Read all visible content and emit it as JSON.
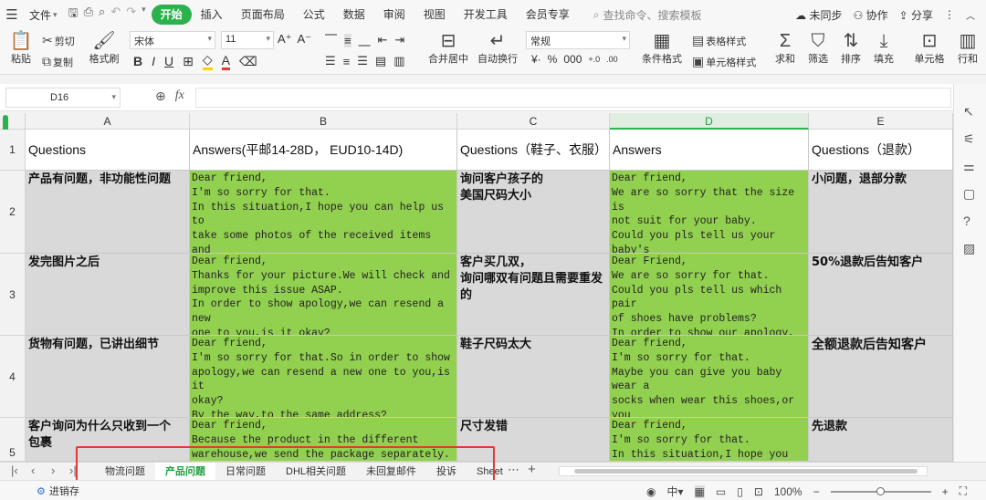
{
  "menubar": {
    "file": "文件",
    "tabs": [
      "开始",
      "插入",
      "页面布局",
      "公式",
      "数据",
      "审阅",
      "视图",
      "开发工具",
      "会员专享"
    ],
    "active_tab": "开始",
    "search_placeholder": "查找命令、搜索模板",
    "sync": "未同步",
    "collab": "协作",
    "share": "分享"
  },
  "ribbon": {
    "paste": "粘贴",
    "cut": "剪切",
    "copy": "复制",
    "format_painter": "格式刷",
    "font_name": "宋体",
    "font_size": "11",
    "merge": "合并居中",
    "wrap": "自动换行",
    "number_format": "常规",
    "table_style": "表格样式",
    "cond_format": "条件格式",
    "cell_style": "单元格样式",
    "sum": "求和",
    "filter": "筛选",
    "sort": "排序",
    "fill": "填充",
    "cell": "单元格",
    "rowcol": "行和"
  },
  "formula": {
    "name_box": "D16",
    "fx": "fx"
  },
  "columns": [
    "A",
    "B",
    "C",
    "D",
    "E"
  ],
  "active_column": "D",
  "rows": [
    "1",
    "2",
    "3",
    "4",
    "5"
  ],
  "cells": {
    "A1": "Questions",
    "B1": "Answers(平邮14-28D， EUD10-14D)",
    "C1": "Questions（鞋子、衣服）",
    "D1": "Answers",
    "E1": "Questions（退款）",
    "A2": "产品有问题，非功能性问题",
    "B2": "Dear friend,\nI'm so sorry for that.\nIn this situation,I hope you can help us to\ntake some photos of the received items and\npackage,and tell me the question in detail.I\nwill feedback to our colleagues that we can",
    "C2": "询问客户孩子的\n美国尺码大小",
    "D2": "Dear friend,\nWe are so sorry that the size is\nnot suit for your baby.\nCould you pls tell us your baby's\nsize by US inch, so that we can\ncheck whether there is suitable",
    "E2": "小问题，退部分款",
    "A3": "发完图片之后",
    "B3": "Dear friend,\nThanks for your picture.We will check and\nimprove this issue ASAP.\nIn order to show apology,we can resend a new\none to you,is it okay?\nBy the way,to the same address?",
    "C3": "客户买几双，\n询问哪双有问题且需要重发\n的",
    "D3": "Dear Friend,\nWe are so sorry for that.\nCould you pls tell us which pair\nof shoes have problems?\nIn order to show our apology, we\ncan resend a new one to you, is it",
    "E3": "50%退款后告知客户",
    "A4": "货物有问题，已讲出细节",
    "B4": "Dear friend,\nI'm so sorry for that.So in order to show\napology,we can resend a new one to you,is it\nokay?\nBy the way,to the same address?",
    "C4": "鞋子尺码太大",
    "D4": "Dear friend,\nI'm so sorry for that.\nMaybe you can give you baby wear a\nsocks when wear this shoes,or you\nalso can wait your baby grow up a\nlittle",
    "E4": "全额退款后告知客户",
    "A5": "客户询问为什么只收到一个\n包裹",
    "B5": "Dear friend,\nBecause the product in the different\nwarehouse,we send the package separately.",
    "C5": "尺寸发错",
    "D5": "Dear friend,\nI'm so sorry for that.\nIn this situation,I hope you can",
    "E5": "先退款"
  },
  "sheet_tabs": [
    "物流问题",
    "产品问题",
    "日常问题",
    "DHL相关问题",
    "未回复邮件",
    "投诉",
    "Sheet"
  ],
  "active_sheet": "产品问题",
  "status": {
    "mode": "进销存",
    "zoom": "100%"
  },
  "colors": {
    "accent": "#2bb24c",
    "green_cell": "#92d050",
    "grey_cell": "#d9d9d9",
    "highlight": "#e53935"
  }
}
